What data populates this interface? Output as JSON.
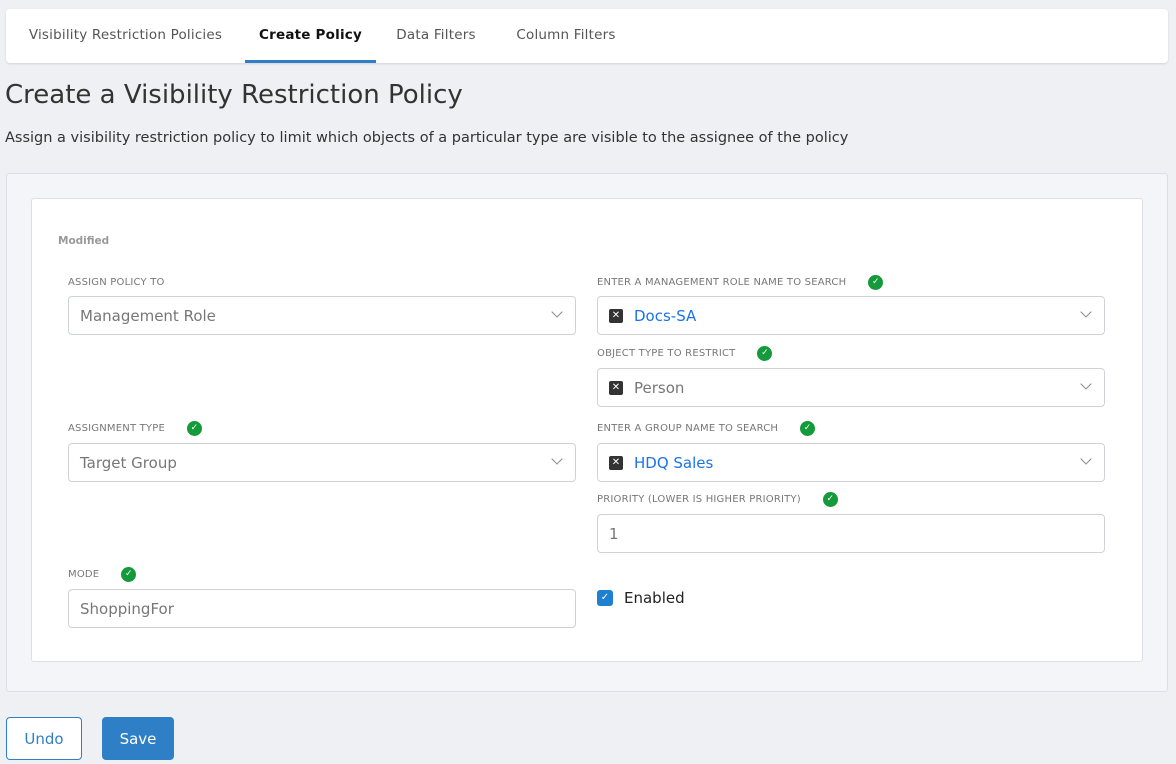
{
  "tabs": [
    {
      "label": "Visibility Restriction Policies",
      "active": false
    },
    {
      "label": "Create Policy",
      "active": true
    },
    {
      "label": "Data Filters",
      "active": false
    },
    {
      "label": "Column Filters",
      "active": false
    }
  ],
  "page": {
    "title": "Create a Visibility Restriction Policy",
    "description": "Assign a visibility restriction policy to limit which objects of a particular type are visible to the assignee of the policy",
    "status": "Modified"
  },
  "form": {
    "assign_policy_to": {
      "label": "ASSIGN POLICY TO",
      "value": "Management Role"
    },
    "management_role": {
      "label": "ENTER A MANAGEMENT ROLE NAME TO SEARCH",
      "value": "Docs-SA"
    },
    "object_type": {
      "label": "OBJECT TYPE TO RESTRICT",
      "value": "Person"
    },
    "assignment_type": {
      "label": "ASSIGNMENT TYPE",
      "value": "Target Group"
    },
    "group": {
      "label": "ENTER A GROUP NAME TO SEARCH",
      "value": "HDQ Sales"
    },
    "priority": {
      "label": "PRIORITY (LOWER IS HIGHER PRIORITY)",
      "value": "1"
    },
    "mode": {
      "label": "MODE",
      "value": "ShoppingFor"
    },
    "enabled": {
      "label": "Enabled",
      "checked": true
    }
  },
  "buttons": {
    "undo": "Undo",
    "save": "Save"
  },
  "colors": {
    "accent": "#2f7fc6",
    "valid": "#149a3b",
    "tag": "#1a73e8"
  }
}
